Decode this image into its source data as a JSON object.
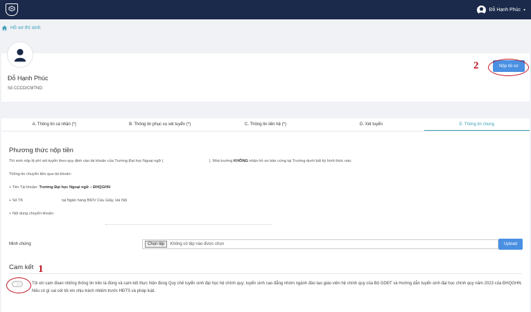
{
  "header": {
    "user_name": "Đỗ Hạnh Phúc",
    "logo_icon": "university-crest-icon",
    "chevron_icon": "chevron-down-icon"
  },
  "breadcrumb": {
    "home_icon": "home-icon",
    "label": "Hồ sơ thí sinh"
  },
  "profile": {
    "name": "Đỗ Hạnh Phúc",
    "id_label": "Số CCCD/CMTND:",
    "submit_label": "Nộp hồ sơ"
  },
  "tabs": [
    {
      "label": "A. Thông tin cá nhân (*)"
    },
    {
      "label": "B. Thông tin phục vụ xét tuyển (*)"
    },
    {
      "label": "C. Thông tin liên hệ (*)"
    },
    {
      "label": "D. Xét tuyển"
    },
    {
      "label": "E. Thông tin chung"
    }
  ],
  "payment": {
    "title": "Phương thức nộp tiền",
    "intro_before": "Thí sinh nộp lệ phí xét tuyển theo quy định vào tài khoản của Trường Đại học Ngoại ngữ (",
    "intro_middle": "). Nhà trường ",
    "intro_strong": "KHÔNG",
    "intro_after": " nhận hồ sơ bản cứng tại Trường dưới bất kỳ hình thức nào.",
    "transfer_heading": "Thông tin chuyển tiền qua tài khoản:",
    "account_name_label": "+ Tên Tài khoản: ",
    "account_name": "Trường Đại học Ngoại ngữ – ĐHQGHN",
    "account_no_label": "+ Số TK",
    "bank": "tại Ngân hàng BIDV Cầu Giấy, Hà Nội",
    "content_label": "+ Nội dung chuyển khoản:"
  },
  "proof": {
    "label": "Minh chứng",
    "choose_file": "Chọn tệp",
    "no_file": "Không có tệp nào được chọn",
    "upload": "Upload"
  },
  "commitment": {
    "title": "Cam kết",
    "text": "Tôi xin cam đoan những thông tin trên là đúng và cam kết thực hiện đúng Quy chế tuyển sinh đại học hệ chính quy; tuyển sinh cao đẳng nhóm ngành đào tạo giáo viên hệ chính quy của Bộ GDĐT và Hướng dẫn tuyển sinh đại học chính quy năm 2023 của ĐHQGHN. Nếu có gì sai sót tôi xin chịu trách nhiệm trước HĐTS và pháp luật."
  },
  "annotations": {
    "submit_marker": "2",
    "toggle_marker": "1",
    "color": "#c0111f"
  }
}
